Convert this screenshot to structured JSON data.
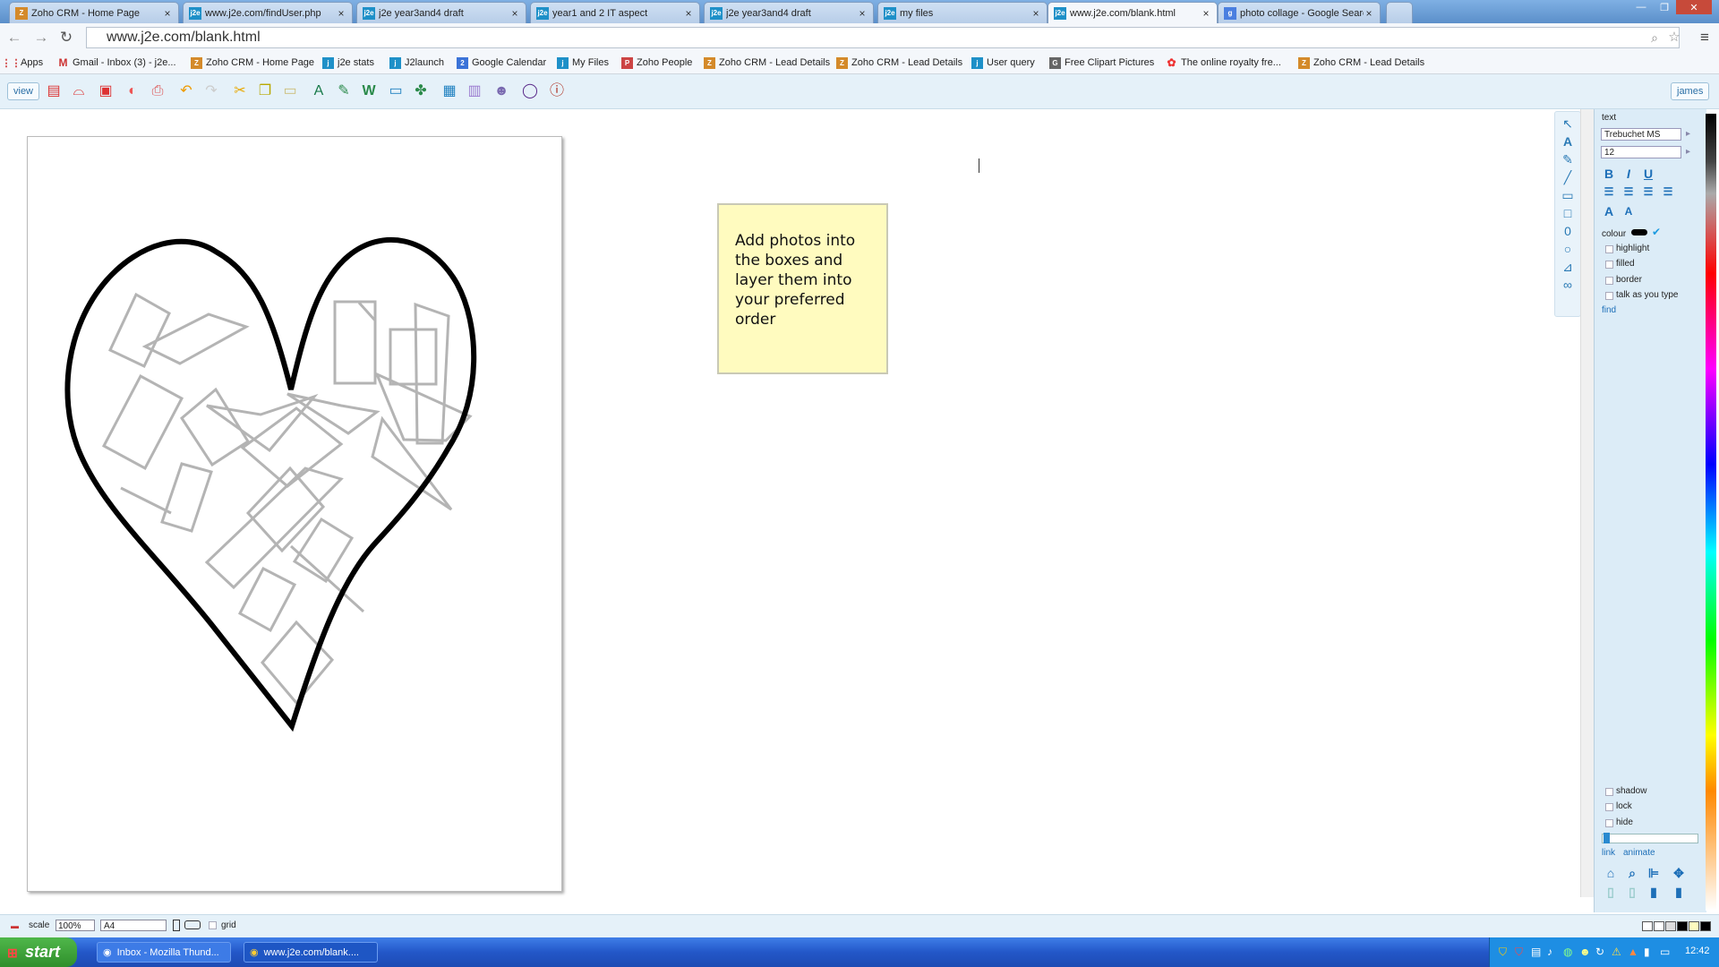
{
  "tabs": [
    {
      "title": "Zoho CRM - Home Page",
      "icon": "zoho-icon",
      "active": false
    },
    {
      "title": "www.j2e.com/findUser.php",
      "icon": "j2e-icon",
      "active": false
    },
    {
      "title": "j2e year3and4 draft",
      "icon": "j2e-icon",
      "active": false
    },
    {
      "title": "year1 and 2 IT aspect",
      "icon": "j2e-icon",
      "active": false
    },
    {
      "title": "j2e year3and4 draft",
      "icon": "j2e-icon",
      "active": false
    },
    {
      "title": "my files",
      "icon": "j2e-icon",
      "active": false
    },
    {
      "title": "www.j2e.com/blank.html",
      "icon": "j2e-icon",
      "active": true
    },
    {
      "title": "photo collage - Google Searc",
      "icon": "google-icon",
      "active": false
    }
  ],
  "address": {
    "url": "www.j2e.com/blank.html"
  },
  "bookmarks": [
    {
      "label": "Apps",
      "icon": "apps-icon"
    },
    {
      "label": "Gmail - Inbox (3) - j2e...",
      "icon": "gmail-icon"
    },
    {
      "label": "Zoho CRM - Home Page",
      "icon": "zoho-icon"
    },
    {
      "label": "j2e stats",
      "icon": "j2e-icon"
    },
    {
      "label": "J2launch",
      "icon": "j2e-icon"
    },
    {
      "label": "Google Calendar",
      "icon": "calendar-icon"
    },
    {
      "label": "My Files",
      "icon": "j2e-icon"
    },
    {
      "label": "Zoho People",
      "icon": "people-icon"
    },
    {
      "label": "Zoho CRM - Lead Details",
      "icon": "zoho-icon"
    },
    {
      "label": "Zoho CRM - Lead Details",
      "icon": "zoho-icon"
    },
    {
      "label": "User query",
      "icon": "j2e-icon"
    },
    {
      "label": "Free Clipart Pictures",
      "icon": "google-icon"
    },
    {
      "label": "The online royalty fre...",
      "icon": "flower-icon"
    },
    {
      "label": "Zoho CRM - Lead Details",
      "icon": "zoho-icon"
    }
  ],
  "toolbar": {
    "view_label": "view",
    "user_label": "james"
  },
  "note": {
    "text": "Add photos into the boxes and layer them into your preferred order",
    "bg": "#fffbbf"
  },
  "panel": {
    "section_label": "text",
    "font_name": "Trebuchet MS",
    "font_size": "12",
    "colour_label": "colour",
    "highlight_label": "highlight",
    "filled_label": "filled",
    "border_label": "border",
    "talk_label": "talk as you type",
    "find_label": "find",
    "shadow_label": "shadow",
    "lock_label": "lock",
    "hide_label": "hide",
    "link_label": "link",
    "animate_label": "animate",
    "accent": "#1d6fb8"
  },
  "statusbar": {
    "scale_label": "scale",
    "scale_value": "100%",
    "paper_value": "A4",
    "grid_label": "grid"
  },
  "taskbar": {
    "start_label": "start",
    "tasks": [
      {
        "label": "Inbox - Mozilla Thund...",
        "icon": "thunderbird-icon"
      },
      {
        "label": "www.j2e.com/blank....",
        "icon": "chrome-icon"
      }
    ],
    "clock": "12:42"
  }
}
